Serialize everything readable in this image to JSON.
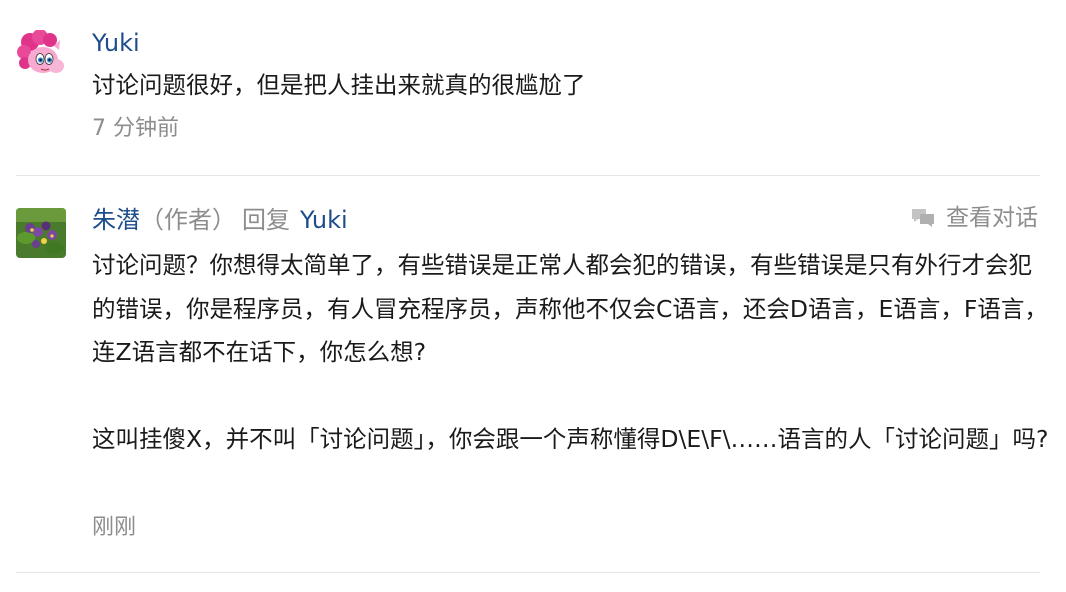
{
  "comments": [
    {
      "author": "Yuki",
      "content": "讨论问题很好，但是把人挂出来就真的很尴尬了",
      "time": "7 分钟前",
      "avatar_icon": "pony-avatar"
    },
    {
      "author": "朱潜",
      "author_tag": "（作者）",
      "reply_word": "回复",
      "reply_to": "Yuki",
      "view_conversation": "查看对话",
      "content_p1": "讨论问题？你想得太简单了，有些错误是正常人都会犯的错误，有些错误是只有外行才会犯的错误，你是程序员，有人冒充程序员，声称他不仅会C语言，还会D语言，E语言，F语言，连Z语言都不在话下，你怎么想?",
      "content_p2": "这叫挂傻X，并不叫「讨论问题」，你会跟一个声称懂得D\\E\\F\\……语言的人「讨论问题」吗?",
      "time": "刚刚",
      "avatar_icon": "flower-avatar"
    }
  ],
  "colors": {
    "link": "#1e4d8c",
    "muted": "#8d8d8d",
    "text": "#1a1a1a",
    "divider": "#e6e6e6"
  }
}
